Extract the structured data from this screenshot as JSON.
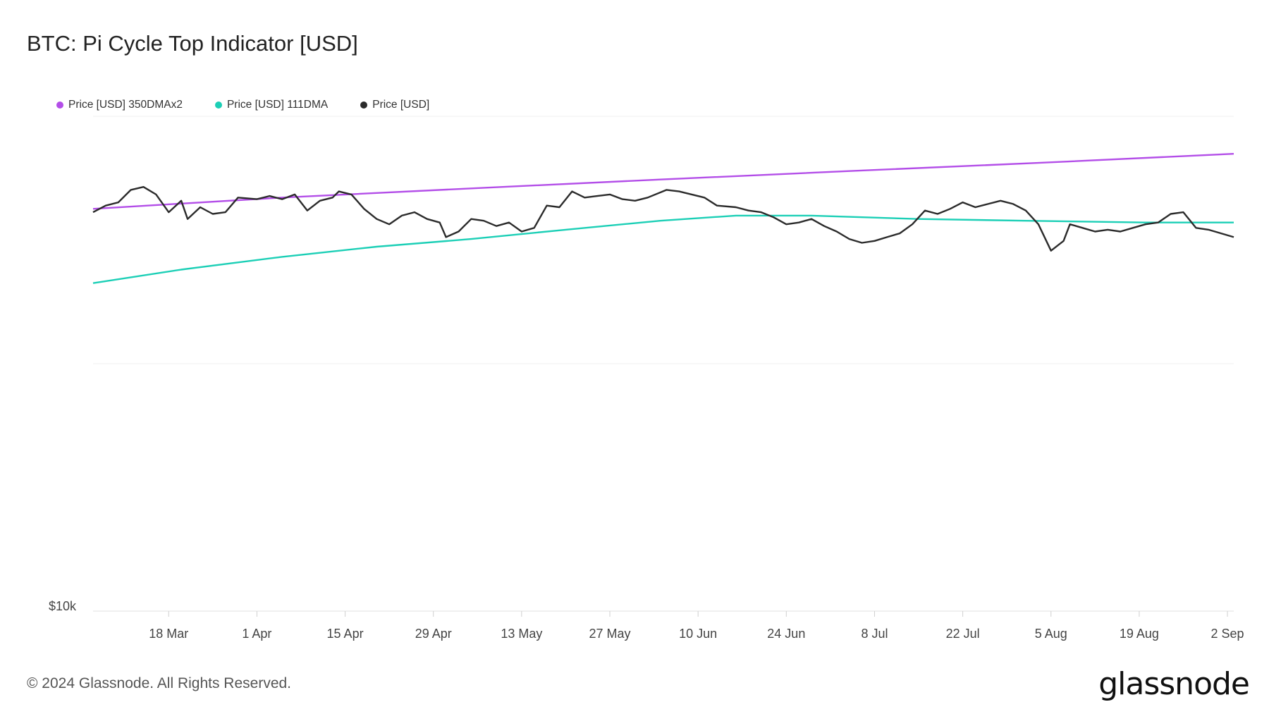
{
  "title": "BTC: Pi Cycle Top Indicator [USD]",
  "footer": "© 2024 Glassnode. All Rights Reserved.",
  "brand": "glassnode",
  "legend": [
    {
      "label": "Price [USD] 350DMAx2",
      "color": "#b34ee8"
    },
    {
      "label": "Price [USD] 111DMA",
      "color": "#1ccfb6"
    },
    {
      "label": "Price [USD]",
      "color": "#2b2b2b"
    }
  ],
  "chart_data": {
    "type": "line",
    "title": "BTC: Pi Cycle Top Indicator [USD]",
    "y_scale": "log",
    "y_tick_labels": [
      "$10k"
    ],
    "x_tick_labels": [
      "18 Mar",
      "1 Apr",
      "15 Apr",
      "29 Apr",
      "13 May",
      "27 May",
      "10 Jun",
      "24 Jun",
      "8 Jul",
      "22 Jul",
      "5 Aug",
      "19 Aug",
      "2 Sep"
    ],
    "x_range": [
      "2024-03-06",
      "2024-09-03"
    ],
    "y_range": [
      10000,
      100000
    ],
    "grid": "horizontal",
    "legend_position": "top-left",
    "series": [
      {
        "name": "Price [USD] 350DMAx2",
        "color": "#b34ee8",
        "points": [
          [
            "2024-03-06",
            65000
          ],
          [
            "2024-04-05",
            68500
          ],
          [
            "2024-05-05",
            71500
          ],
          [
            "2024-06-04",
            74500
          ],
          [
            "2024-07-04",
            77500
          ],
          [
            "2024-08-03",
            80500
          ],
          [
            "2024-09-03",
            84000
          ]
        ]
      },
      {
        "name": "Price [USD] 111DMA",
        "color": "#1ccfb6",
        "points": [
          [
            "2024-03-06",
            46000
          ],
          [
            "2024-03-20",
            49000
          ],
          [
            "2024-04-05",
            52000
          ],
          [
            "2024-04-20",
            54500
          ],
          [
            "2024-05-05",
            56500
          ],
          [
            "2024-05-20",
            59000
          ],
          [
            "2024-06-04",
            61500
          ],
          [
            "2024-06-16",
            63000
          ],
          [
            "2024-06-28",
            63000
          ],
          [
            "2024-07-15",
            62000
          ],
          [
            "2024-08-01",
            61500
          ],
          [
            "2024-08-20",
            61000
          ],
          [
            "2024-09-03",
            61000
          ]
        ]
      },
      {
        "name": "Price [USD]",
        "color": "#2b2b2b",
        "points": [
          [
            "2024-03-06",
            64000
          ],
          [
            "2024-03-08",
            66000
          ],
          [
            "2024-03-10",
            67000
          ],
          [
            "2024-03-12",
            71000
          ],
          [
            "2024-03-14",
            72000
          ],
          [
            "2024-03-16",
            69500
          ],
          [
            "2024-03-18",
            64000
          ],
          [
            "2024-03-20",
            67500
          ],
          [
            "2024-03-21",
            62000
          ],
          [
            "2024-03-23",
            65500
          ],
          [
            "2024-03-25",
            63500
          ],
          [
            "2024-03-27",
            64000
          ],
          [
            "2024-03-29",
            68500
          ],
          [
            "2024-04-01",
            68000
          ],
          [
            "2024-04-03",
            69000
          ],
          [
            "2024-04-05",
            68000
          ],
          [
            "2024-04-07",
            69500
          ],
          [
            "2024-04-09",
            64500
          ],
          [
            "2024-04-11",
            67500
          ],
          [
            "2024-04-13",
            68500
          ],
          [
            "2024-04-14",
            70500
          ],
          [
            "2024-04-16",
            69500
          ],
          [
            "2024-04-18",
            65000
          ],
          [
            "2024-04-20",
            62000
          ],
          [
            "2024-04-22",
            60500
          ],
          [
            "2024-04-24",
            63000
          ],
          [
            "2024-04-26",
            64000
          ],
          [
            "2024-04-28",
            62000
          ],
          [
            "2024-04-30",
            61000
          ],
          [
            "2024-05-01",
            57000
          ],
          [
            "2024-05-03",
            58500
          ],
          [
            "2024-05-05",
            62000
          ],
          [
            "2024-05-07",
            61500
          ],
          [
            "2024-05-09",
            60000
          ],
          [
            "2024-05-11",
            61000
          ],
          [
            "2024-05-13",
            58500
          ],
          [
            "2024-05-15",
            59500
          ],
          [
            "2024-05-17",
            66000
          ],
          [
            "2024-05-19",
            65500
          ],
          [
            "2024-05-21",
            70500
          ],
          [
            "2024-05-23",
            68500
          ],
          [
            "2024-05-25",
            69000
          ],
          [
            "2024-05-27",
            69500
          ],
          [
            "2024-05-29",
            68000
          ],
          [
            "2024-05-31",
            67500
          ],
          [
            "2024-06-02",
            68500
          ],
          [
            "2024-06-05",
            71000
          ],
          [
            "2024-06-07",
            70500
          ],
          [
            "2024-06-09",
            69500
          ],
          [
            "2024-06-11",
            68500
          ],
          [
            "2024-06-13",
            66000
          ],
          [
            "2024-06-16",
            65500
          ],
          [
            "2024-06-18",
            64500
          ],
          [
            "2024-06-20",
            64000
          ],
          [
            "2024-06-22",
            62500
          ],
          [
            "2024-06-24",
            60500
          ],
          [
            "2024-06-26",
            61000
          ],
          [
            "2024-06-28",
            62000
          ],
          [
            "2024-06-30",
            60000
          ],
          [
            "2024-07-02",
            58500
          ],
          [
            "2024-07-04",
            56500
          ],
          [
            "2024-07-06",
            55500
          ],
          [
            "2024-07-08",
            56000
          ],
          [
            "2024-07-10",
            57000
          ],
          [
            "2024-07-12",
            58000
          ],
          [
            "2024-07-14",
            60500
          ],
          [
            "2024-07-16",
            64500
          ],
          [
            "2024-07-18",
            63500
          ],
          [
            "2024-07-20",
            65000
          ],
          [
            "2024-07-22",
            67000
          ],
          [
            "2024-07-24",
            65500
          ],
          [
            "2024-07-26",
            66500
          ],
          [
            "2024-07-28",
            67500
          ],
          [
            "2024-07-30",
            66500
          ],
          [
            "2024-08-01",
            64500
          ],
          [
            "2024-08-03",
            60500
          ],
          [
            "2024-08-05",
            53500
          ],
          [
            "2024-08-07",
            56000
          ],
          [
            "2024-08-08",
            60500
          ],
          [
            "2024-08-10",
            59500
          ],
          [
            "2024-08-12",
            58500
          ],
          [
            "2024-08-14",
            59000
          ],
          [
            "2024-08-16",
            58500
          ],
          [
            "2024-08-18",
            59500
          ],
          [
            "2024-08-20",
            60500
          ],
          [
            "2024-08-22",
            61000
          ],
          [
            "2024-08-24",
            63500
          ],
          [
            "2024-08-26",
            64000
          ],
          [
            "2024-08-28",
            59500
          ],
          [
            "2024-08-30",
            59000
          ],
          [
            "2024-09-01",
            58000
          ],
          [
            "2024-09-03",
            57000
          ]
        ]
      }
    ]
  }
}
